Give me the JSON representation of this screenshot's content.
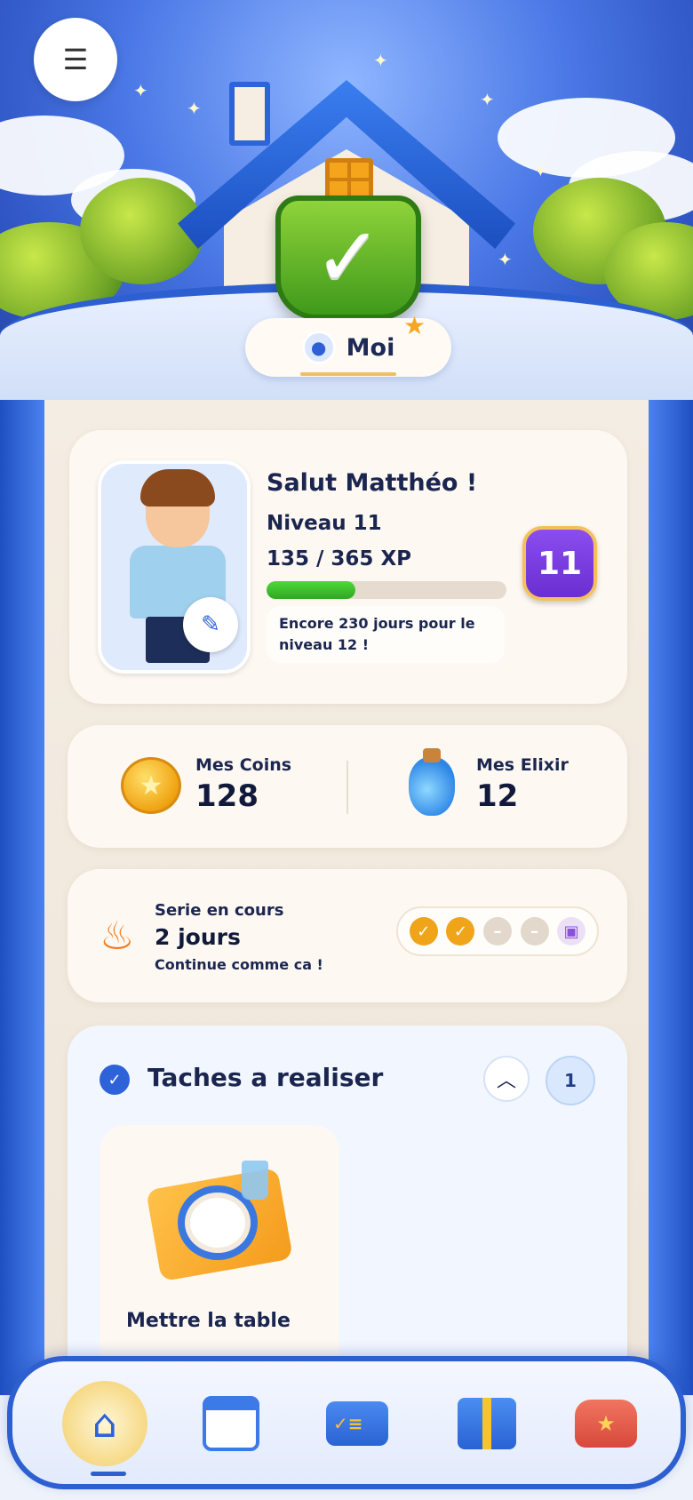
{
  "header": {
    "menu_icon": "hamburger-icon",
    "banner_icon": "checkmark-shield-icon",
    "tab_label": "Moi",
    "tab_icon": "user-icon"
  },
  "profile": {
    "greeting": "Salut Matthéo !",
    "level_label": "Niveau 11",
    "xp_label": "135 / 365 XP",
    "xp_progress": 0.37,
    "next_level_note": "Encore 230 jours pour le niveau 12 !",
    "level_badge": "11",
    "edit_icon": "pencil-icon"
  },
  "wallet": {
    "coins_label": "Mes Coins",
    "coins_value": "128",
    "elixir_label": "Mes Elixir",
    "elixir_value": "12"
  },
  "streak": {
    "title": "Serie en cours",
    "days": "2 jours",
    "message": "Continue comme ca !",
    "slots": [
      "done",
      "done",
      "todo",
      "todo",
      "gift"
    ]
  },
  "tasks": {
    "title": "Taches a realiser",
    "count": "1",
    "items": [
      {
        "name": "Mettre la table",
        "icon": "table-setting-icon"
      }
    ]
  },
  "nav": {
    "items": [
      {
        "icon": "home-icon",
        "active": true
      },
      {
        "icon": "calendar-icon",
        "active": false
      },
      {
        "icon": "task-list-icon",
        "active": false
      },
      {
        "icon": "gift-icon",
        "active": false
      },
      {
        "icon": "backpack-icon",
        "active": false
      }
    ]
  },
  "colors": {
    "primary_blue": "#2d5fd0",
    "xp_green": "#2ea822",
    "level_purple": "#6a2fd0",
    "streak_orange": "#f0a41a"
  }
}
